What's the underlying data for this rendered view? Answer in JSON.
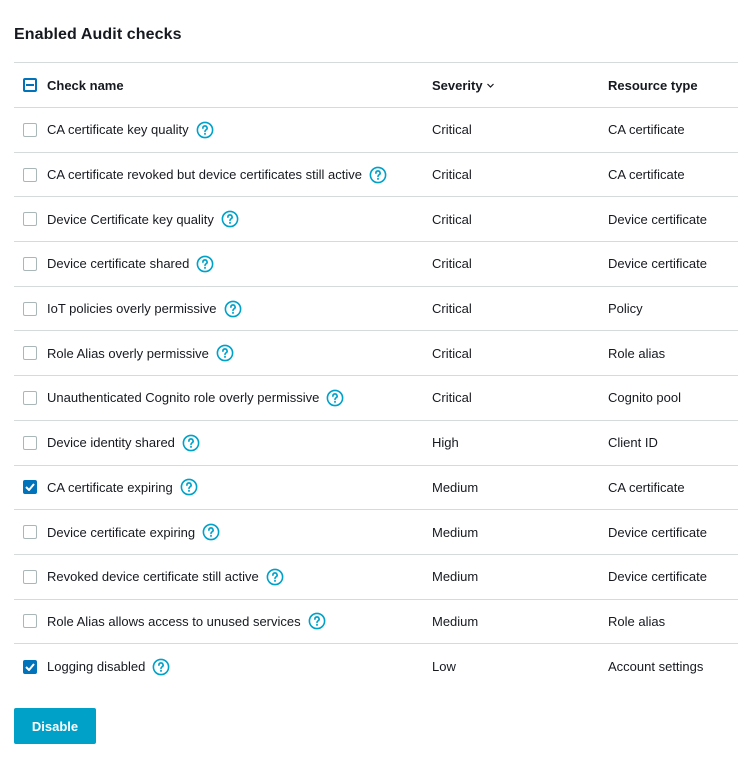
{
  "title": "Enabled Audit checks",
  "columns": {
    "check_name": "Check name",
    "severity": "Severity",
    "resource_type": "Resource type"
  },
  "rows": [
    {
      "name": "CA certificate key quality",
      "severity": "Critical",
      "resource": "CA certificate",
      "checked": false
    },
    {
      "name": "CA certificate revoked but device certificates still active",
      "severity": "Critical",
      "resource": "CA certificate",
      "checked": false
    },
    {
      "name": "Device Certificate key quality",
      "severity": "Critical",
      "resource": "Device certificate",
      "checked": false
    },
    {
      "name": "Device certificate shared",
      "severity": "Critical",
      "resource": "Device certificate",
      "checked": false
    },
    {
      "name": "IoT policies overly permissive",
      "severity": "Critical",
      "resource": "Policy",
      "checked": false
    },
    {
      "name": "Role Alias overly permissive",
      "severity": "Critical",
      "resource": "Role alias",
      "checked": false
    },
    {
      "name": "Unauthenticated Cognito role overly permissive",
      "severity": "Critical",
      "resource": "Cognito pool",
      "checked": false
    },
    {
      "name": "Device identity shared",
      "severity": "High",
      "resource": "Client ID",
      "checked": false
    },
    {
      "name": "CA certificate expiring",
      "severity": "Medium",
      "resource": "CA certificate",
      "checked": true
    },
    {
      "name": "Device certificate expiring",
      "severity": "Medium",
      "resource": "Device certificate",
      "checked": false
    },
    {
      "name": "Revoked device certificate still active",
      "severity": "Medium",
      "resource": "Device certificate",
      "checked": false
    },
    {
      "name": "Role Alias allows access to unused services",
      "severity": "Medium",
      "resource": "Role alias",
      "checked": false
    },
    {
      "name": "Logging disabled",
      "severity": "Low",
      "resource": "Account settings",
      "checked": true
    }
  ],
  "header_checkbox_state": "indeterminate",
  "icons": {
    "help": "help-circle-icon",
    "sort": "chevron-down-icon"
  },
  "colors": {
    "accent_blue": "#0073bb",
    "help_icon": "#00a1c9",
    "button_bg": "#00a1c9",
    "divider": "#d5dbdb"
  },
  "disable_button": "Disable"
}
